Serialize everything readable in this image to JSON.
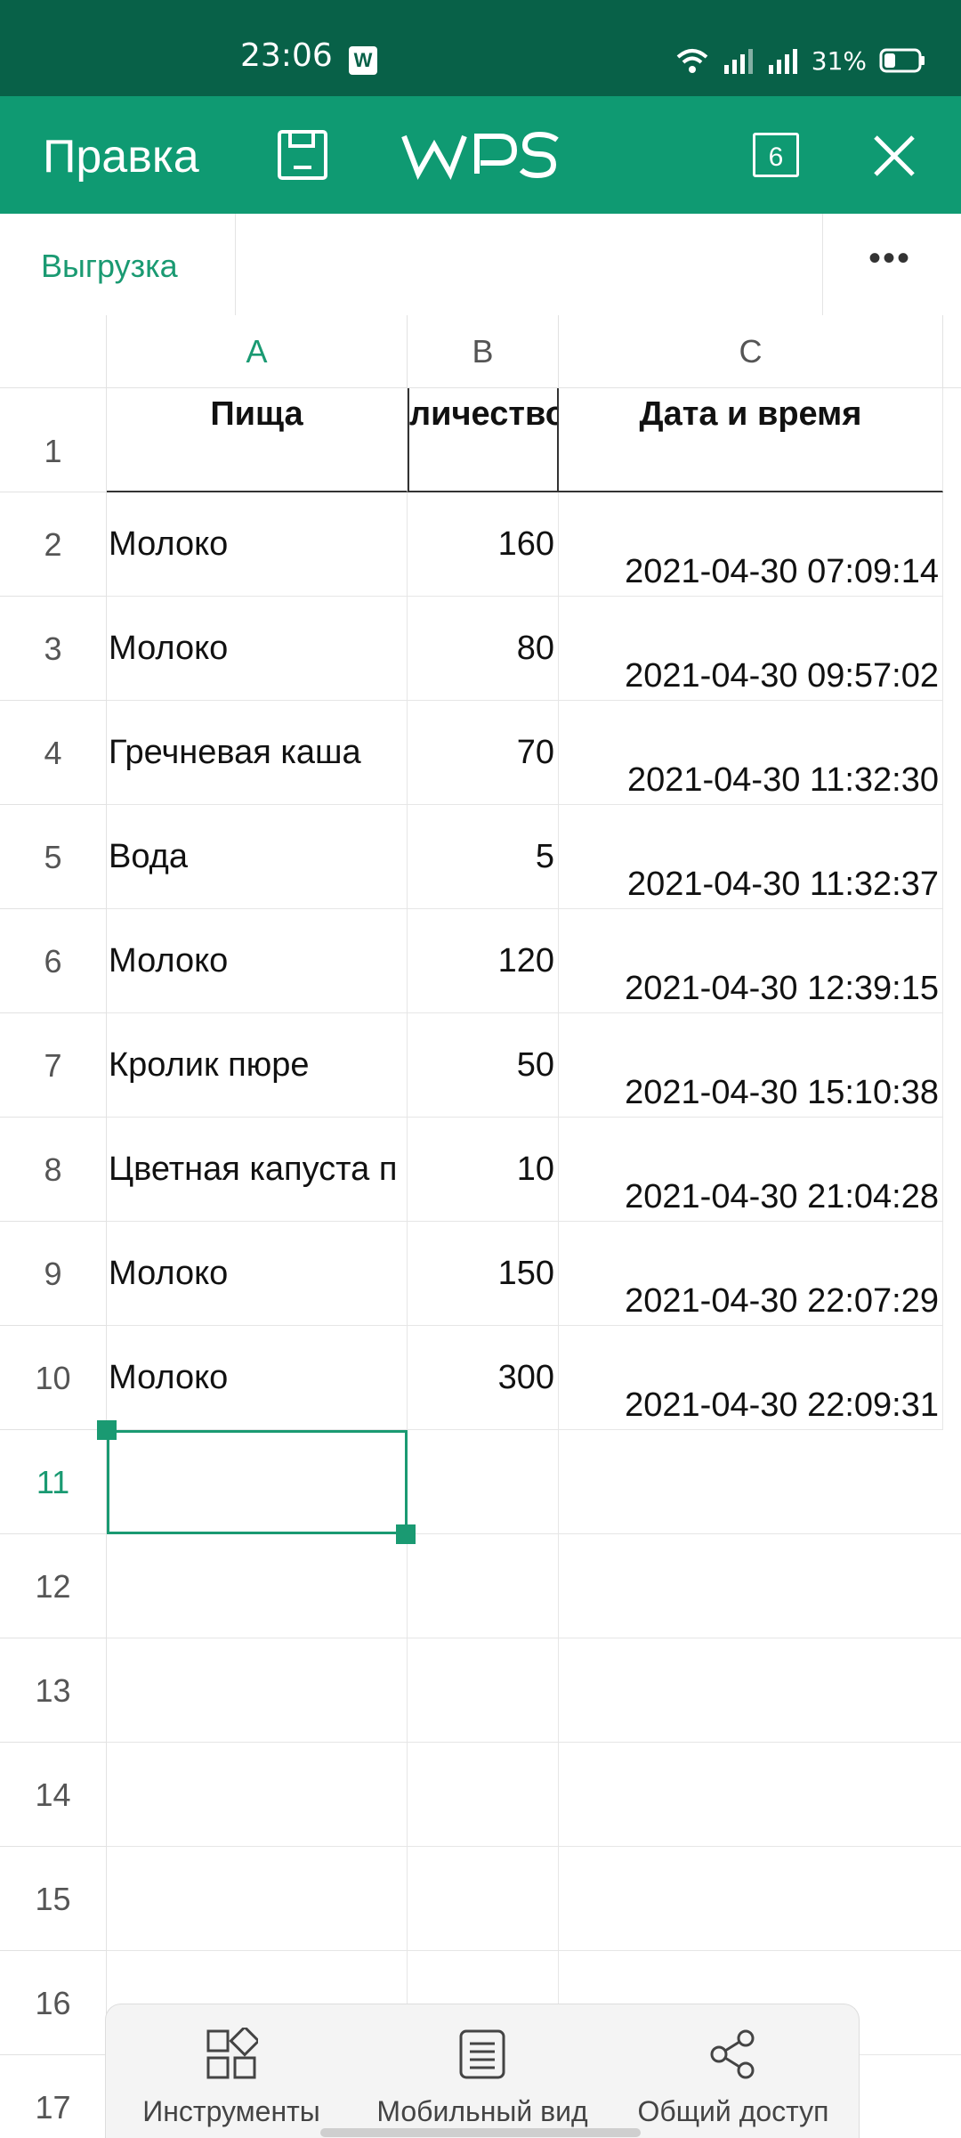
{
  "status_bar": {
    "time": "23:06",
    "battery": "31%",
    "app_badge": "W"
  },
  "toolbar": {
    "title": "Правка",
    "logo": "WPS",
    "tab_count": "6"
  },
  "subbar": {
    "export_label": "Выгрузка",
    "more_label": "•••"
  },
  "sheet": {
    "columns": [
      "A",
      "B",
      "C"
    ],
    "rows": [
      "1",
      "2",
      "3",
      "4",
      "5",
      "6",
      "7",
      "8",
      "9",
      "10",
      "11",
      "12",
      "13",
      "14",
      "15",
      "16",
      "17"
    ],
    "header": {
      "a": "Пища",
      "b": "личество,",
      "c": "Дата и время"
    },
    "data": [
      {
        "a": "Молоко",
        "b": "160",
        "c": "2021-04-30 07:09:14"
      },
      {
        "a": "Молоко",
        "b": "80",
        "c": "2021-04-30 09:57:02"
      },
      {
        "a": "Гречневая каша",
        "b": "70",
        "c": "2021-04-30 11:32:30"
      },
      {
        "a": "Вода",
        "b": "5",
        "c": "2021-04-30 11:32:37"
      },
      {
        "a": "Молоко",
        "b": "120",
        "c": "2021-04-30 12:39:15"
      },
      {
        "a": "Кролик пюре",
        "b": "50",
        "c": "2021-04-30 15:10:38"
      },
      {
        "a": "Цветная капуста п",
        "b": "10",
        "c": "2021-04-30 21:04:28"
      },
      {
        "a": "Молоко",
        "b": "150",
        "c": "2021-04-30 22:07:29"
      },
      {
        "a": "Молоко",
        "b": "300",
        "c": "2021-04-30 22:09:31"
      }
    ]
  },
  "bottom_bar": {
    "tools": "Инструменты",
    "mobile_view": "Мобильный вид",
    "share": "Общий доступ"
  },
  "colors": {
    "status_bar": "#086148",
    "toolbar": "#0f9a72",
    "accent": "#1a9a72"
  }
}
